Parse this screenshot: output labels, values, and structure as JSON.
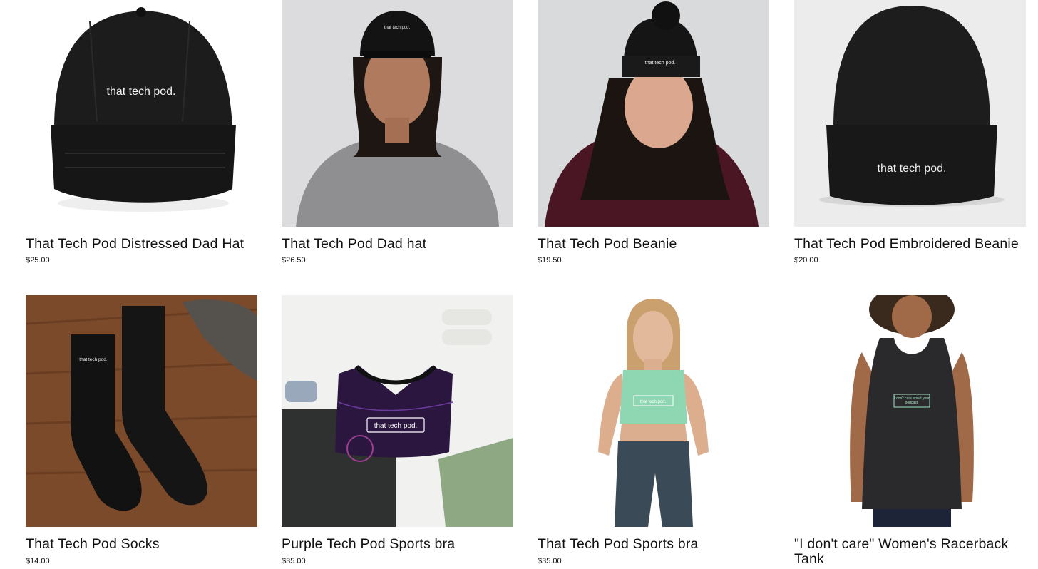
{
  "products": [
    {
      "title": "That Tech Pod Distressed Dad Hat",
      "price": "$25.00",
      "logo": "that tech pod.",
      "icon": "distressed-cap-image"
    },
    {
      "title": "That Tech Pod Dad hat",
      "price": "$26.50",
      "logo": "that tech pod.",
      "icon": "model-dad-hat-image"
    },
    {
      "title": "That Tech Pod Beanie",
      "price": "$19.50",
      "logo": "that tech pod.",
      "icon": "model-pom-beanie-image"
    },
    {
      "title": "That Tech Pod Embroidered Beanie",
      "price": "$20.00",
      "logo": "that tech pod.",
      "icon": "embroidered-beanie-image"
    },
    {
      "title": "That Tech Pod Socks",
      "price": "$14.00",
      "logo": "that tech pod.",
      "icon": "socks-image"
    },
    {
      "title": "Purple Tech Pod Sports bra",
      "price": "$35.00",
      "logo": "that tech pod.",
      "icon": "purple-sports-bra-image"
    },
    {
      "title": "That Tech Pod Sports bra",
      "price": "$35.00",
      "logo": "that tech pod.",
      "icon": "model-sports-bra-image"
    },
    {
      "title": "\"I don't care\" Women's Racerback Tank",
      "price": "",
      "logo": "I don't care about your podcast.",
      "icon": "model-racerback-tank-image"
    }
  ]
}
